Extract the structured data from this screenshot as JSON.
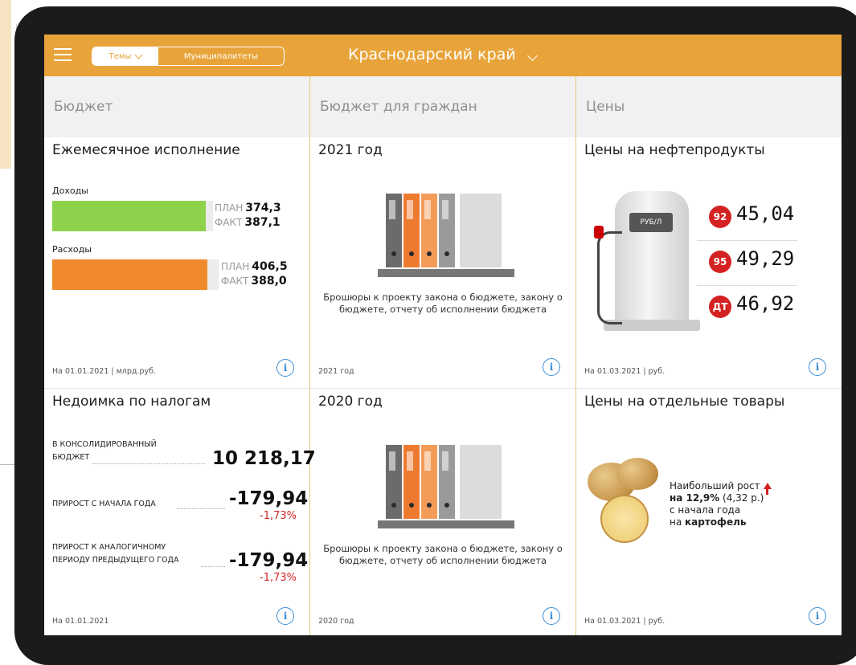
{
  "header": {
    "tab_active": "Темы",
    "tab_other": "Муниципалитеты",
    "region": "Краснодарский край"
  },
  "columns": [
    "Бюджет",
    "Бюджет для граждан",
    "Цены"
  ],
  "budget": {
    "title": "Ежемесячное исполнение",
    "income_label": "Доходы",
    "income_plan_label": "ПЛАН",
    "income_plan": "374,3",
    "income_fact_label": "ФАКТ",
    "income_fact": "387,1",
    "expense_label": "Расходы",
    "expense_plan_label": "ПЛАН",
    "expense_plan": "406,5",
    "expense_fact_label": "ФАКТ",
    "expense_fact": "388,0",
    "footer": "На 01.01.2021 | млрд.руб.",
    "income_color": "#8ed14a",
    "expense_color": "#f08a2c"
  },
  "citizens_2021": {
    "title": "2021 год",
    "description": "Брошюры к проекту закона о бюджете, закону о бюджете, отчету об исполнении бюджета",
    "footer": "2021 год"
  },
  "citizens_2020": {
    "title": "2020 год",
    "description": "Брошюры к проекту закона о бюджете, закону о бюджете, отчету об исполнении бюджета",
    "footer": "2020 год"
  },
  "fuel": {
    "title": "Цены на нефтепродукты",
    "pump_screen": "РУБ/Л",
    "items": [
      {
        "grade": "92",
        "price": "45,04"
      },
      {
        "grade": "95",
        "price": "49,29"
      },
      {
        "grade": "ДТ",
        "price": "46,92"
      }
    ],
    "footer": "На 01.03.2021 | руб."
  },
  "tax": {
    "title": "Недоимка по налогам",
    "consolidated_label_1": "В КОНСОЛИДИРОВАННЫЙ",
    "consolidated_label_2": "БЮДЖЕТ",
    "consolidated_value": "10 218,17",
    "growth_year_label": "ПРИРОСТ С НАЧАЛА ГОДА",
    "growth_year_value": "-179,94",
    "growth_year_pct": "-1,73%",
    "growth_prev_label_1": "ПРИРОСТ К АНАЛОГИЧНОМУ",
    "growth_prev_label_2": "ПЕРИОДУ ПРЕДЫДУЩЕГО ГОДА",
    "growth_prev_value": "-179,94",
    "growth_prev_pct": "-1,73%",
    "footer": "На 01.01.2021"
  },
  "goods": {
    "title": "Цены на отдельные товары",
    "line1": "Наибольший рост",
    "line2_bold": "на 12,9%",
    "line2_rest": " (4,32 р.)",
    "line3": "с начала года",
    "line4_prefix": "на ",
    "line4_bold": "картофель",
    "footer": "На 01.03.2021 | руб."
  },
  "icons": {
    "info": "i"
  }
}
